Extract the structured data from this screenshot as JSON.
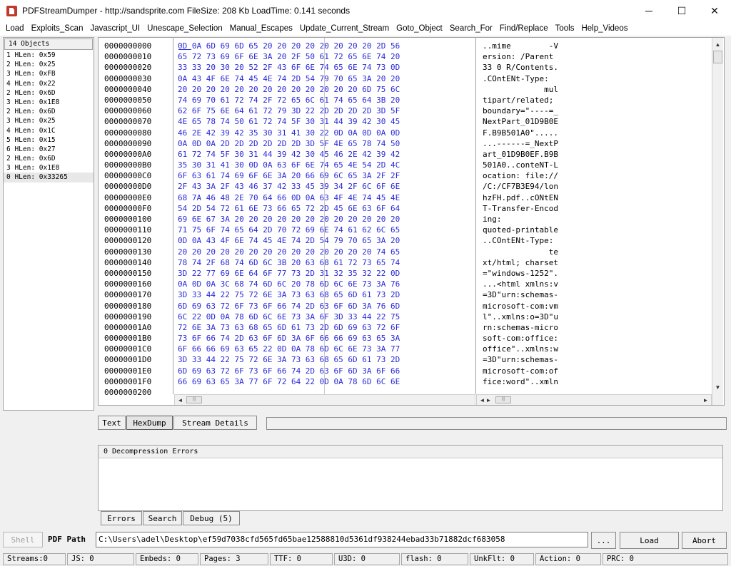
{
  "window": {
    "title": "PDFStreamDumper  - http://sandsprite.com    FileSize: 208 Kb   LoadTime: 0.141 seconds",
    "minimize": "─",
    "maximize": "☐",
    "close": "✕"
  },
  "menu": [
    "Load",
    "Exploits_Scan",
    "Javascript_UI",
    "Unescape_Selection",
    "Manual_Escapes",
    "Update_Current_Stream",
    "Goto_Object",
    "Search_For",
    "Find/Replace",
    "Tools",
    "Help_Videos"
  ],
  "objects": {
    "header": "14 Objects",
    "items": [
      "1 HLen: 0x59",
      "2 HLen: 0x25",
      "3 HLen: 0xFB",
      "4 HLen: 0x22",
      "2 HLen: 0x6D",
      "3 HLen: 0x1E8",
      "2 HLen: 0x6D",
      "3 HLen: 0x25",
      "4 HLen: 0x1C",
      "5 HLen: 0x15",
      "6 HLen: 0x27",
      "2 HLen: 0x6D",
      "3 HLen: 0x1E8",
      "0 HLen: 0x33265"
    ],
    "selected_index": 13
  },
  "hexdump": {
    "addresses": [
      "0000000000",
      "0000000010",
      "0000000020",
      "0000000030",
      "0000000040",
      "0000000050",
      "0000000060",
      "0000000070",
      "0000000080",
      "0000000090",
      "00000000A0",
      "00000000B0",
      "00000000C0",
      "00000000D0",
      "00000000E0",
      "00000000F0",
      "0000000100",
      "0000000110",
      "0000000120",
      "0000000130",
      "0000000140",
      "0000000150",
      "0000000160",
      "0000000170",
      "0000000180",
      "0000000190",
      "00000001A0",
      "00000001B0",
      "00000001C0",
      "00000001D0",
      "00000001E0",
      "00000001F0",
      "0000000200"
    ],
    "hex": [
      "0D 0A 6D 69 6D 65 20 20 20 20 20 20 20 20 2D 56",
      "65 72 73 69 6F 6E 3A 20 2F 50 61 72 65 6E 74 20",
      "33 33 20 30 20 52 2F 43 6F 6E 74 65 6E 74 73 0D",
      "0A 43 4F 6E 74 45 4E 74 2D 54 79 70 65 3A 20 20",
      "20 20 20 20 20 20 20 20 20 20 20 20 20 6D 75 6C",
      "74 69 70 61 72 74 2F 72 65 6C 61 74 65 64 3B 20",
      "62 6F 75 6E 64 61 72 79 3D 22 2D 2D 2D 2D 3D 5F",
      "4E 65 78 74 50 61 72 74 5F 30 31 44 39 42 30 45",
      "46 2E 42 39 42 35 30 31 41 30 22 0D 0A 0D 0A 0D",
      "0A 0D 0A 2D 2D 2D 2D 2D 2D 3D 5F 4E 65 78 74 50",
      "61 72 74 5F 30 31 44 39 42 30 45 46 2E 42 39 42",
      "35 30 31 41 30 0D 0A 63 6F 6E 74 65 4E 54 2D 4C",
      "6F 63 61 74 69 6F 6E 3A 20 66 69 6C 65 3A 2F 2F",
      "2F 43 3A 2F 43 46 37 42 33 45 39 34 2F 6C 6F 6E",
      "68 7A 46 48 2E 70 64 66 0D 0A 63 4F 4E 74 45 4E",
      "54 2D 54 72 61 6E 73 66 65 72 2D 45 6E 63 6F 64",
      "69 6E 67 3A 20 20 20 20 20 20 20 20 20 20 20 20",
      "71 75 6F 74 65 64 2D 70 72 69 6E 74 61 62 6C 65",
      "0D 0A 43 4F 6E 74 45 4E 74 2D 54 79 70 65 3A 20",
      "20 20 20 20 20 20 20 20 20 20 20 20 20 20 74 65",
      "78 74 2F 68 74 6D 6C 3B 20 63 68 61 72 73 65 74",
      "3D 22 77 69 6E 64 6F 77 73 2D 31 32 35 32 22 0D",
      "0A 0D 0A 3C 68 74 6D 6C 20 78 6D 6C 6E 73 3A 76",
      "3D 33 44 22 75 72 6E 3A 73 63 68 65 6D 61 73 2D",
      "6D 69 63 72 6F 73 6F 66 74 2D 63 6F 6D 3A 76 6D",
      "6C 22 0D 0A 78 6D 6C 6E 73 3A 6F 3D 33 44 22 75",
      "72 6E 3A 73 63 68 65 6D 61 73 2D 6D 69 63 72 6F",
      "73 6F 66 74 2D 63 6F 6D 3A 6F 66 66 69 63 65 3A",
      "6F 66 66 69 63 65 22 0D 0A 78 6D 6C 6E 73 3A 77",
      "3D 33 44 22 75 72 6E 3A 73 63 68 65 6D 61 73 2D",
      "6D 69 63 72 6F 73 6F 66 74 2D 63 6F 6D 3A 6F 66",
      "66 69 63 65 3A 77 6F 72 64 22 0D 0A 78 6D 6C 6E",
      ""
    ],
    "ascii": [
      "..mime        -V",
      "ersion: /Parent ",
      "33 0 R/Contents.",
      ".COntENt-Type:  ",
      "             mul",
      "tipart/related; ",
      "boundary=\"----=_",
      "NextPart_01D9B0E",
      "F.B9B501A0\".....",
      "...------=_NextP",
      "art_01D9B0EF.B9B",
      "501A0..conteNT-L",
      "ocation: file://",
      "/C:/CF7B3E94/lon",
      "hzFH.pdf..cONtEN",
      "T-Transfer-Encod",
      "ing:            ",
      "quoted-printable",
      "..COntENt-Type: ",
      "              te",
      "xt/html; charset",
      "=\"windows-1252\".",
      "...<html xmlns:v",
      "=3D\"urn:schemas-",
      "microsoft-com:vm",
      "l\"..xmlns:o=3D\"u",
      "rn:schemas-micro",
      "soft-com:office:",
      "office\"..xmlns:w",
      "=3D\"urn:schemas-",
      "microsoft-com:of",
      "fice:word\"..xmln",
      ""
    ]
  },
  "tabs": [
    "Text",
    "HexDump",
    "Stream Details"
  ],
  "errors": {
    "header": "0 Decompression Errors",
    "tabs": [
      "Errors",
      "Search",
      "Debug (5)"
    ]
  },
  "pathbar": {
    "shell": "Shell",
    "label": "PDF Path",
    "value": "C:\\Users\\adel\\Desktop\\ef59d7038cfd565fd65bae12588810d5361df938244ebad33b71882dcf683058",
    "browse": "...",
    "load": "Load",
    "abort": "Abort"
  },
  "status": {
    "streams": "Streams:0",
    "js": "JS: 0",
    "embeds": "Embeds: 0",
    "pages": "Pages: 3",
    "ttf": "TTF: 0",
    "u3d": "U3D: 0",
    "flash": "flash: 0",
    "unkflt": "UnkFlt: 0",
    "action": "Action: 0",
    "prc": "PRC: 0"
  },
  "scroll": {
    "left": "◄",
    "right": "►",
    "up": "▲",
    "down": "▼",
    "grip": "|||"
  }
}
